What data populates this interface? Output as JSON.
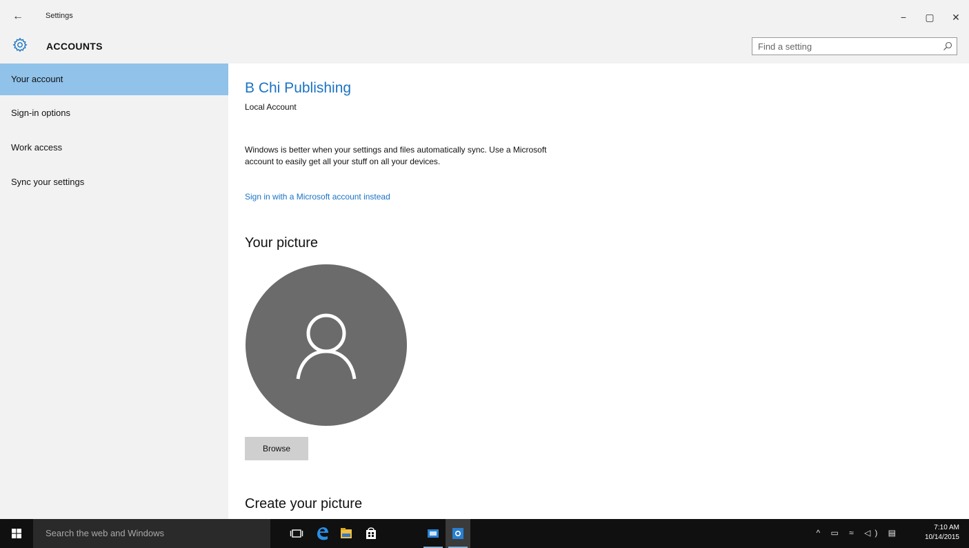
{
  "titlebar": {
    "back_glyph": "←",
    "app_title": "Settings",
    "minimize_glyph": "−",
    "maximize_glyph": "▢",
    "close_glyph": "✕"
  },
  "header": {
    "section_title": "ACCOUNTS",
    "search_placeholder": "Find a setting"
  },
  "sidebar": {
    "items": [
      {
        "label": "Your account",
        "active": true
      },
      {
        "label": "Sign-in options"
      },
      {
        "label": "Work access"
      },
      {
        "label": "Sync your settings"
      }
    ]
  },
  "main": {
    "account_name": "B Chi Publishing",
    "account_type": "Local Account",
    "sync_text": "Windows is better when your settings and files automatically sync. Use a Microsoft account to easily get all your stuff on all your devices.",
    "ms_link": "Sign in with a Microsoft account instead",
    "picture_heading": "Your picture",
    "browse_label": "Browse",
    "create_heading": "Create your picture"
  },
  "taskbar": {
    "search_placeholder": "Search the web and Windows",
    "time": "7:10 AM",
    "date": "10/14/2015",
    "tray_icons_text": "^ ▭ ≈ ◁) ▤"
  },
  "colors": {
    "accent": "#1a73c4",
    "nav_active": "#90c2ea",
    "chrome_bg": "#f2f2f2",
    "avatar_bg": "#6b6b6b",
    "taskbar_bg": "#101010"
  }
}
